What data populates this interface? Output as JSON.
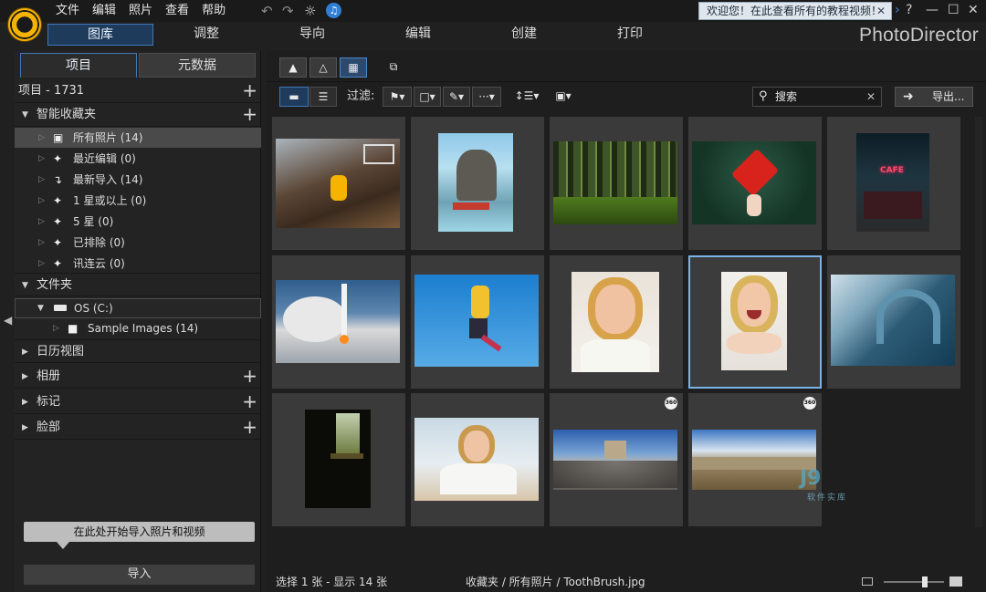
{
  "titlebar": {
    "menu": [
      "文件",
      "编辑",
      "照片",
      "查看",
      "帮助"
    ],
    "tutorial_text": "欢迎您！在此查看所有的教程视频！",
    "help": "?"
  },
  "modules": [
    "图库",
    "调整",
    "导向",
    "编辑",
    "创建",
    "打印"
  ],
  "brand": "PhotoDirector",
  "left": {
    "tabs": [
      "项目",
      "元数据"
    ],
    "project_count": "项目 - 1731",
    "smart_collections": "智能收藏夹",
    "items": [
      {
        "label": "所有照片",
        "count": "(14)"
      },
      {
        "label": "最近编辑",
        "count": "(0)"
      },
      {
        "label": "最新导入",
        "count": "(14)"
      },
      {
        "label": "1 星或以上",
        "count": "(0)"
      },
      {
        "label": "5 星",
        "count": "(0)"
      },
      {
        "label": "已排除",
        "count": "(0)"
      },
      {
        "label": "讯连云",
        "count": "(0)"
      }
    ],
    "folders": "文件夹",
    "drive": "OS (C:)",
    "sample": "Sample Images",
    "sample_count": "(14)",
    "calendar": "日历视图",
    "albums": "相册",
    "tags": "标记",
    "faces": "脸部",
    "tooltip": "在此处开始导入照片和视频",
    "import": "导入"
  },
  "toolbar": {
    "filter_label": "过滤:",
    "search_text": "搜索",
    "export": "导出..."
  },
  "status": {
    "selection": "选择 1 张 - 显示 14 张",
    "path": "收藏夹 / 所有照片 / ToothBrush.jpg"
  },
  "watermark": {
    "big": "J9",
    "small": "软件实库"
  },
  "colors": {
    "accent": "#3f78b5",
    "selected_border": "#79b4e8",
    "notify": "#2f7fd6"
  },
  "photos": [
    {
      "name": "basketball-dunk",
      "badge": ""
    },
    {
      "name": "rock-island",
      "badge": ""
    },
    {
      "name": "forest",
      "badge": ""
    },
    {
      "name": "red-maple-leaf",
      "badge": ""
    },
    {
      "name": "neon-cafe",
      "badge": ""
    },
    {
      "name": "rocket-launch",
      "badge": ""
    },
    {
      "name": "skateboard-jump",
      "badge": ""
    },
    {
      "name": "smiling-woman",
      "badge": ""
    },
    {
      "name": "laughing-woman",
      "badge": ""
    },
    {
      "name": "ocean-wave",
      "badge": ""
    },
    {
      "name": "dark-window",
      "badge": ""
    },
    {
      "name": "woman-beach",
      "badge": ""
    },
    {
      "name": "panorama-plaza",
      "badge": "360"
    },
    {
      "name": "panorama-mountain",
      "badge": "360"
    }
  ]
}
